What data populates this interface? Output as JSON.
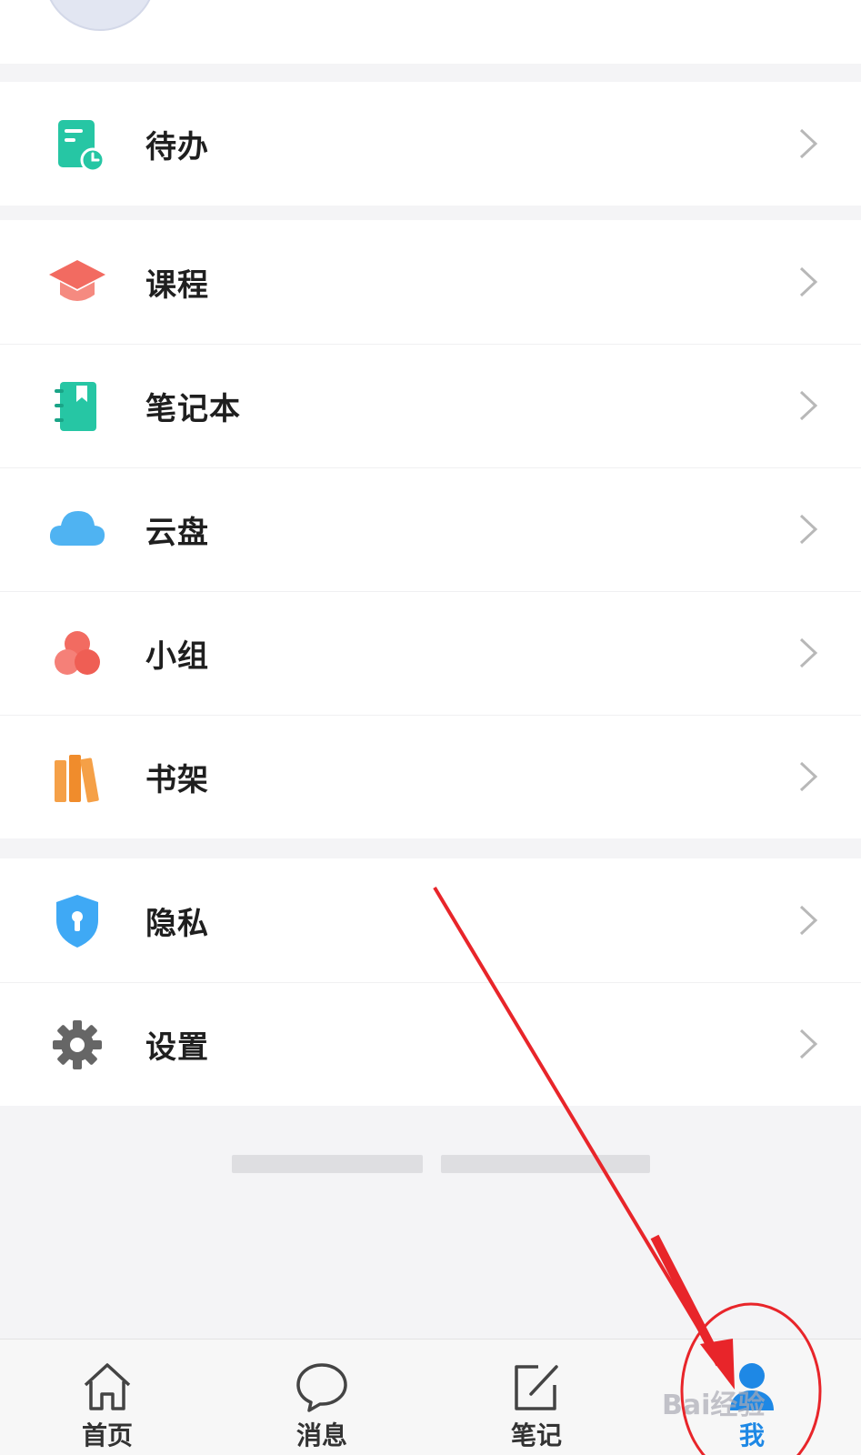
{
  "menu_groups": [
    {
      "items": [
        {
          "label": "待办",
          "icon": "todo-list-icon"
        }
      ]
    },
    {
      "items": [
        {
          "label": "课程",
          "icon": "graduation-cap-icon"
        },
        {
          "label": "笔记本",
          "icon": "notebook-icon"
        },
        {
          "label": "云盘",
          "icon": "cloud-icon"
        },
        {
          "label": "小组",
          "icon": "group-circles-icon"
        },
        {
          "label": "书架",
          "icon": "bookshelf-icon"
        }
      ]
    },
    {
      "items": [
        {
          "label": "隐私",
          "icon": "shield-lock-icon"
        },
        {
          "label": "设置",
          "icon": "gear-icon"
        }
      ]
    }
  ],
  "tabbar": {
    "items": [
      {
        "label": "首页",
        "icon": "home-icon",
        "active": false
      },
      {
        "label": "消息",
        "icon": "chat-bubble-icon",
        "active": false
      },
      {
        "label": "笔记",
        "icon": "edit-note-icon",
        "active": false
      },
      {
        "label": "我",
        "icon": "user-icon",
        "active": true
      }
    ]
  },
  "watermark": {
    "text": "Bai经验"
  },
  "colors": {
    "accent": "#1e88e5",
    "teal": "#26c6a4",
    "coral": "#f26b61",
    "sky": "#4fb3f2",
    "orange": "#f5a047",
    "shield": "#3fa9f5",
    "gear": "#666666",
    "annotation_red": "#e8252a"
  }
}
